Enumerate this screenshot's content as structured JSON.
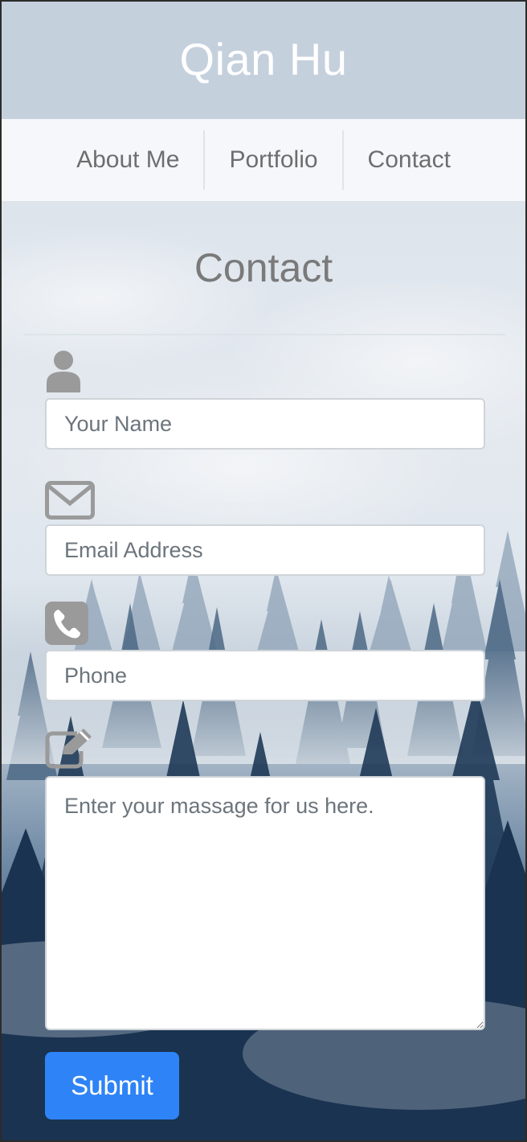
{
  "header": {
    "title": "Qian Hu"
  },
  "nav": {
    "items": [
      {
        "label": "About Me"
      },
      {
        "label": "Portfolio"
      },
      {
        "label": "Contact"
      }
    ]
  },
  "contact": {
    "title": "Contact",
    "fields": [
      {
        "icon": "user-icon",
        "placeholder": "Your Name",
        "value": ""
      },
      {
        "icon": "envelope-icon",
        "placeholder": "Email Address",
        "value": ""
      },
      {
        "icon": "phone-icon",
        "placeholder": "Phone",
        "value": ""
      },
      {
        "icon": "edit-icon",
        "placeholder": "Enter your massage for us here.",
        "value": ""
      }
    ],
    "submit_label": "Submit"
  },
  "colors": {
    "header_bg": "#c5d0dd",
    "nav_bg": "#f5f7fa",
    "nav_text": "#6e6e6e",
    "title_text": "#7a7a7a",
    "icon_gray": "#9a9a9a",
    "submit_bg": "#2e84f6"
  }
}
